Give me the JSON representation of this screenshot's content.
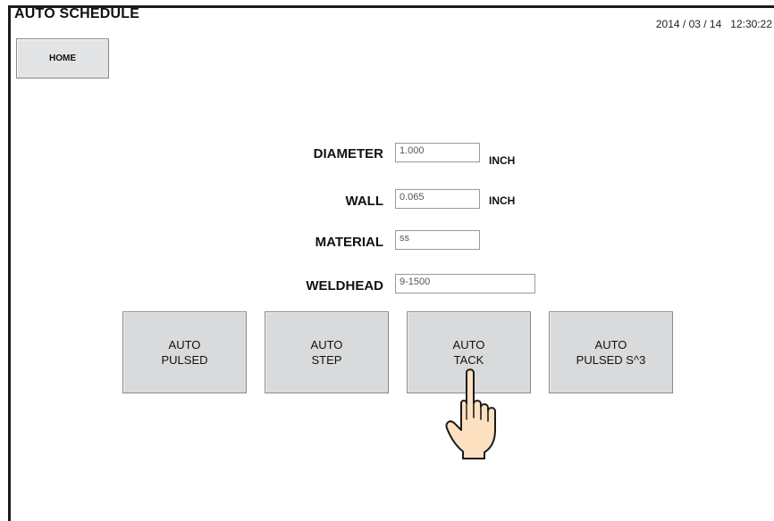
{
  "header": {
    "title": "AUTO SCHEDULE",
    "date": "2014 / 03 / 14",
    "time": "12:30:22"
  },
  "nav": {
    "home_label": "HOME"
  },
  "form": {
    "diameter": {
      "label": "DIAMETER",
      "value": "1.000",
      "unit": "INCH"
    },
    "wall": {
      "label": "WALL",
      "value": "0.065",
      "unit": "INCH"
    },
    "material": {
      "label": "MATERIAL",
      "value": "ss"
    },
    "weldhead": {
      "label": "WELDHEAD",
      "value": "9-1500"
    }
  },
  "buttons": [
    {
      "label": "AUTO\nPULSED"
    },
    {
      "label": "AUTO\nSTEP"
    },
    {
      "label": "AUTO\nTACK"
    },
    {
      "label": "AUTO\nPULSED S^3"
    }
  ],
  "icons": {
    "pointer": "pointing-hand-icon"
  },
  "colors": {
    "button_bg": "#d9dadc",
    "skin": "#fde0c0",
    "outline": "#1a1a1a"
  }
}
